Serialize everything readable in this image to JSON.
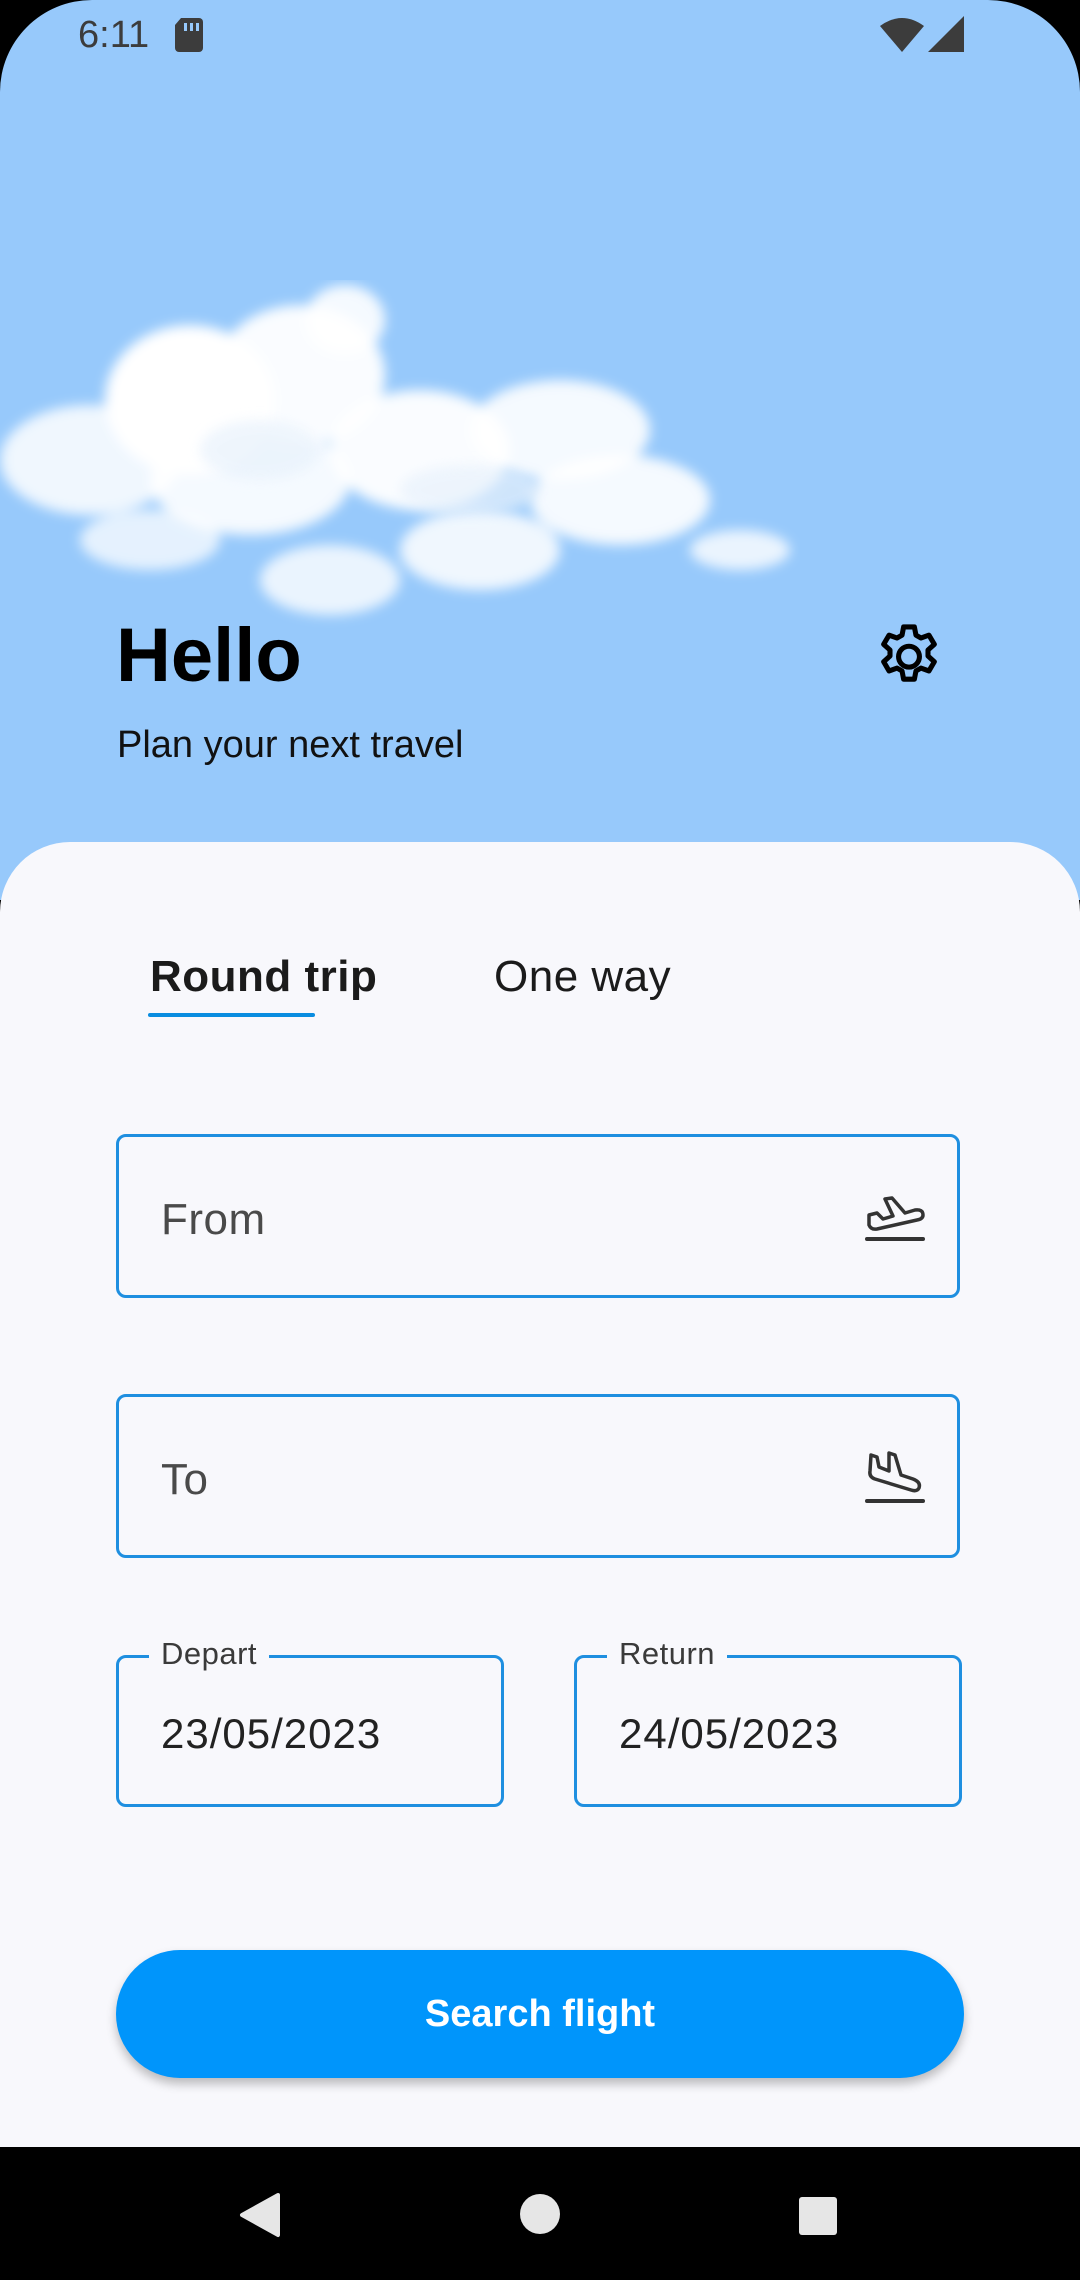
{
  "status_bar": {
    "time": "6:11",
    "icons": [
      "sd-card-icon",
      "wifi-icon",
      "cellular-signal-icon"
    ]
  },
  "header": {
    "greeting": "Hello",
    "subtitle": "Plan your next travel",
    "settings_icon": "gear-icon"
  },
  "tabs": {
    "items": [
      {
        "label": "Round trip",
        "selected": true
      },
      {
        "label": "One way",
        "selected": false
      }
    ]
  },
  "form": {
    "from": {
      "placeholder": "From",
      "icon": "airplane-takeoff-icon"
    },
    "to": {
      "placeholder": "To",
      "icon": "airplane-landing-icon"
    },
    "depart": {
      "label": "Depart",
      "value": "23/05/2023"
    },
    "return": {
      "label": "Return",
      "value": "24/05/2023"
    },
    "search_button": "Search flight"
  },
  "nav_bar": {
    "icons": [
      "back-icon",
      "home-icon",
      "recents-icon"
    ]
  },
  "colors": {
    "sky": "#97c9fb",
    "accent": "#0095fb",
    "field_border": "#1f8fe0",
    "card_background": "#f8f8fc"
  }
}
